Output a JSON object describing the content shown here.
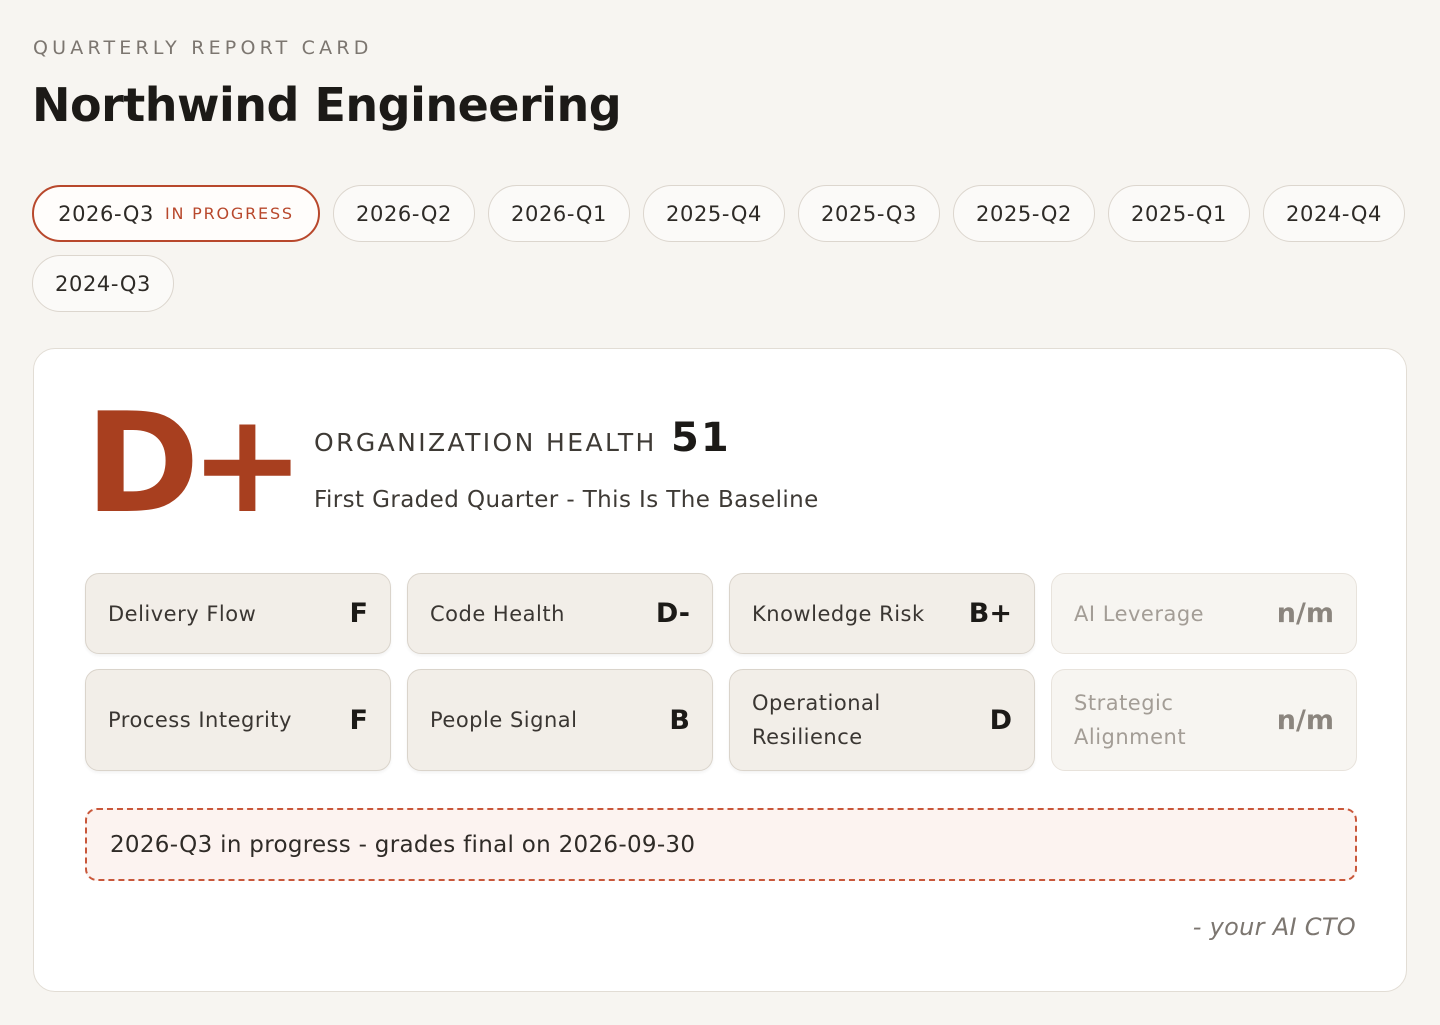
{
  "header": {
    "eyebrow": "QUARTERLY REPORT CARD",
    "title": "Northwind Engineering"
  },
  "quarters": {
    "active": {
      "label": "2026-Q3",
      "badge": "IN PROGRESS"
    },
    "others": [
      "2026-Q2",
      "2026-Q1",
      "2025-Q4",
      "2025-Q3",
      "2025-Q2",
      "2025-Q1",
      "2024-Q4",
      "2024-Q3"
    ]
  },
  "summary": {
    "grade": "D+",
    "health_label": "ORGANIZATION HEALTH",
    "health_score": "51",
    "note": "First Graded Quarter - This Is The Baseline"
  },
  "dimensions": [
    {
      "name": "Delivery Flow",
      "grade": "F"
    },
    {
      "name": "Code Health",
      "grade": "D-"
    },
    {
      "name": "Knowledge Risk",
      "grade": "B+"
    },
    {
      "name": "AI Leverage",
      "grade": "n/m"
    },
    {
      "name": "Process Integrity",
      "grade": "F"
    },
    {
      "name": "People Signal",
      "grade": "B"
    },
    {
      "name": "Operational Resilience",
      "grade": "D"
    },
    {
      "name": "Strategic Alignment",
      "grade": "n/m"
    }
  ],
  "progress_note": "2026-Q3 in progress - grades final on 2026-09-30",
  "signature": "- your AI CTO",
  "colors": {
    "accent": "#b8482c",
    "grade": "#a83f1f",
    "background": "#f7f5f1"
  }
}
